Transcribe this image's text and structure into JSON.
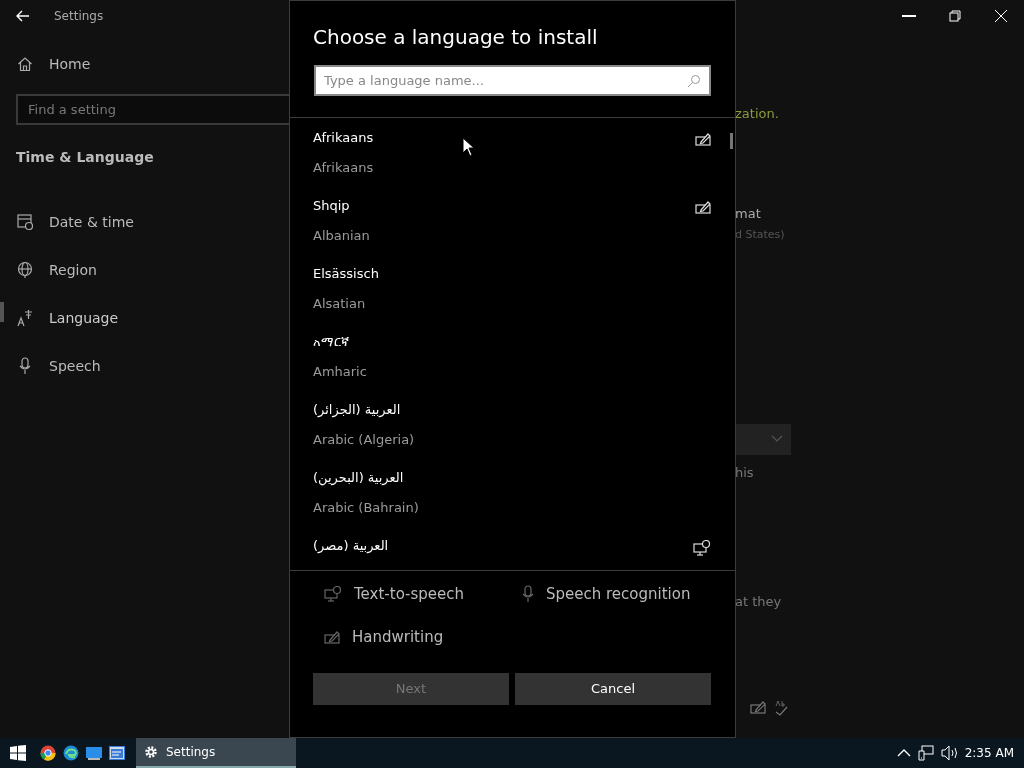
{
  "window": {
    "title": "Settings"
  },
  "sidebar": {
    "home": "Home",
    "search": {
      "placeholder": "Find a setting"
    },
    "section": "Time & Language",
    "items": [
      {
        "label": "Date & time",
        "kind": "calendar",
        "selected": false
      },
      {
        "label": "Region",
        "kind": "globe",
        "selected": false
      },
      {
        "label": "Language",
        "kind": "language",
        "selected": true
      },
      {
        "label": "Speech",
        "kind": "microphone",
        "selected": false
      }
    ]
  },
  "background_content": {
    "fragments": [
      {
        "kind": "link",
        "text": "zation."
      },
      {
        "kind": "heading",
        "text": "mat"
      },
      {
        "kind": "sub",
        "text": "d States)"
      },
      {
        "kind": "dropdown"
      },
      {
        "kind": "text",
        "text": "his"
      },
      {
        "kind": "text",
        "text": "at they"
      },
      {
        "kind": "feature-icons"
      }
    ]
  },
  "dialog": {
    "title": "Choose a language to install",
    "search": {
      "placeholder": "Type a language name..."
    },
    "languages": [
      {
        "native": "Afrikaans",
        "english": "Afrikaans",
        "handwriting": true
      },
      {
        "native": "Shqip",
        "english": "Albanian",
        "handwriting": true
      },
      {
        "native": "Elsässisch",
        "english": "Alsatian"
      },
      {
        "native": "አማርኛ",
        "english": "Amharic"
      },
      {
        "native": "العربية (الجزائر)",
        "english": "Arabic (Algeria)"
      },
      {
        "native": "العربية (البحرين)",
        "english": "Arabic (Bahrain)"
      },
      {
        "native": "العربية (مصر)",
        "text_to_speech": true
      }
    ],
    "legend": [
      {
        "kind": "text-to-speech",
        "label": "Text-to-speech"
      },
      {
        "kind": "speech-recognition",
        "label": "Speech recognition"
      },
      {
        "kind": "handwriting",
        "label": "Handwriting"
      }
    ],
    "buttons": [
      {
        "label": "Next",
        "disabled": true
      },
      {
        "label": "Cancel",
        "disabled": false
      }
    ]
  },
  "taskbar": {
    "apps": [
      {
        "kind": "browser"
      },
      {
        "kind": "edge"
      },
      {
        "kind": "monitor"
      },
      {
        "kind": "window"
      }
    ],
    "active_task": "Settings",
    "clock": "2:35 AM"
  }
}
